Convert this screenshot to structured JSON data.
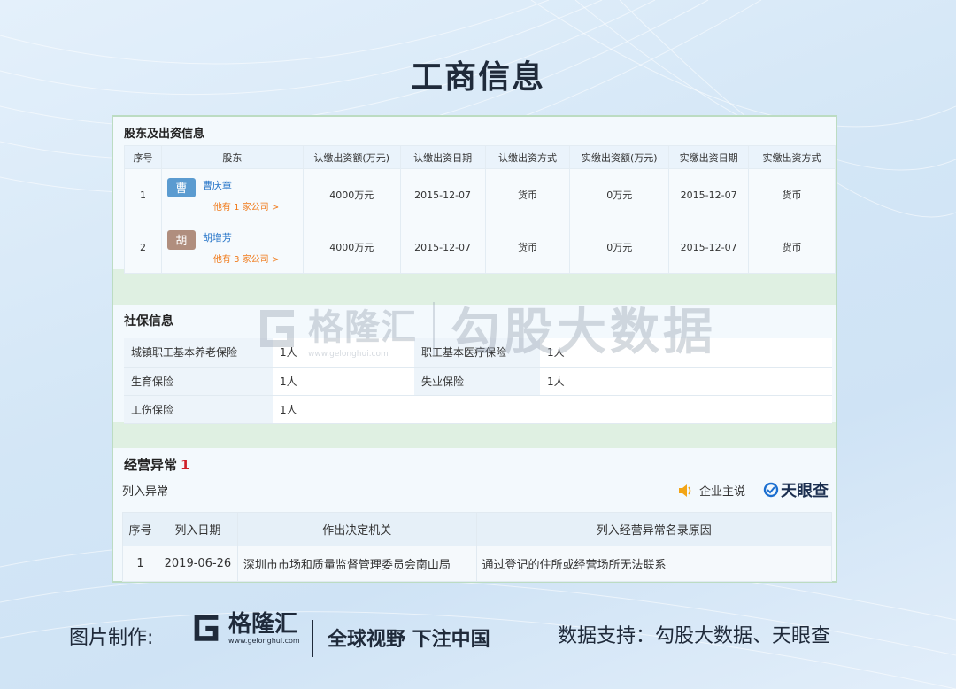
{
  "title": "工商信息",
  "shareholders": {
    "section_title": "股东及出资信息",
    "columns": [
      "序号",
      "股东",
      "认缴出资额(万元)",
      "认缴出资日期",
      "认缴出资方式",
      "实缴出资额(万元)",
      "实缴出资日期",
      "实缴出资方式"
    ],
    "rows": [
      {
        "index": "1",
        "avatar_char": "曹",
        "avatar_color": "#5b9bd0",
        "name": "曹庆章",
        "other": "他有 1 家公司 >",
        "subscribed_amount": "4000万元",
        "subscribed_date": "2015-12-07",
        "subscribed_method": "货币",
        "paid_amount": "0万元",
        "paid_date": "2015-12-07",
        "paid_method": "货币"
      },
      {
        "index": "2",
        "avatar_char": "胡",
        "avatar_color": "#b08e7e",
        "name": "胡增芳",
        "other": "他有 3 家公司 >",
        "subscribed_amount": "4000万元",
        "subscribed_date": "2015-12-07",
        "subscribed_method": "货币",
        "paid_amount": "0万元",
        "paid_date": "2015-12-07",
        "paid_method": "货币"
      }
    ]
  },
  "social_security": {
    "section_title": "社保信息",
    "items": [
      {
        "label": "城镇职工基本养老保险",
        "value": "1人"
      },
      {
        "label": "职工基本医疗保险",
        "value": "1人"
      },
      {
        "label": "生育保险",
        "value": "1人"
      },
      {
        "label": "失业保险",
        "value": "1人"
      },
      {
        "label": "工伤保险",
        "value": "1人"
      }
    ]
  },
  "abnormal": {
    "section_title": "经营异常",
    "count": "1",
    "subtitle": "列入异常",
    "brand_a": "企业主说",
    "brand_b": "天眼查",
    "columns": [
      "序号",
      "列入日期",
      "作出决定机关",
      "列入经营异常名录原因"
    ],
    "rows": [
      {
        "index": "1",
        "date": "2019-06-26",
        "authority": "深圳市市场和质量监督管理委员会南山局",
        "reason": "通过登记的住所或经营场所无法联系"
      }
    ]
  },
  "watermark": {
    "logo_text": "格隆汇",
    "url": "www.gelonghui.com",
    "big_text": "勾股大数据"
  },
  "footer": {
    "label": "图片制作:",
    "logo_text": "格隆汇",
    "logo_url": "www.gelonghui.com",
    "slogan": "全球视野 下注中国",
    "credit": "数据支持：勾股大数据、天眼查"
  }
}
